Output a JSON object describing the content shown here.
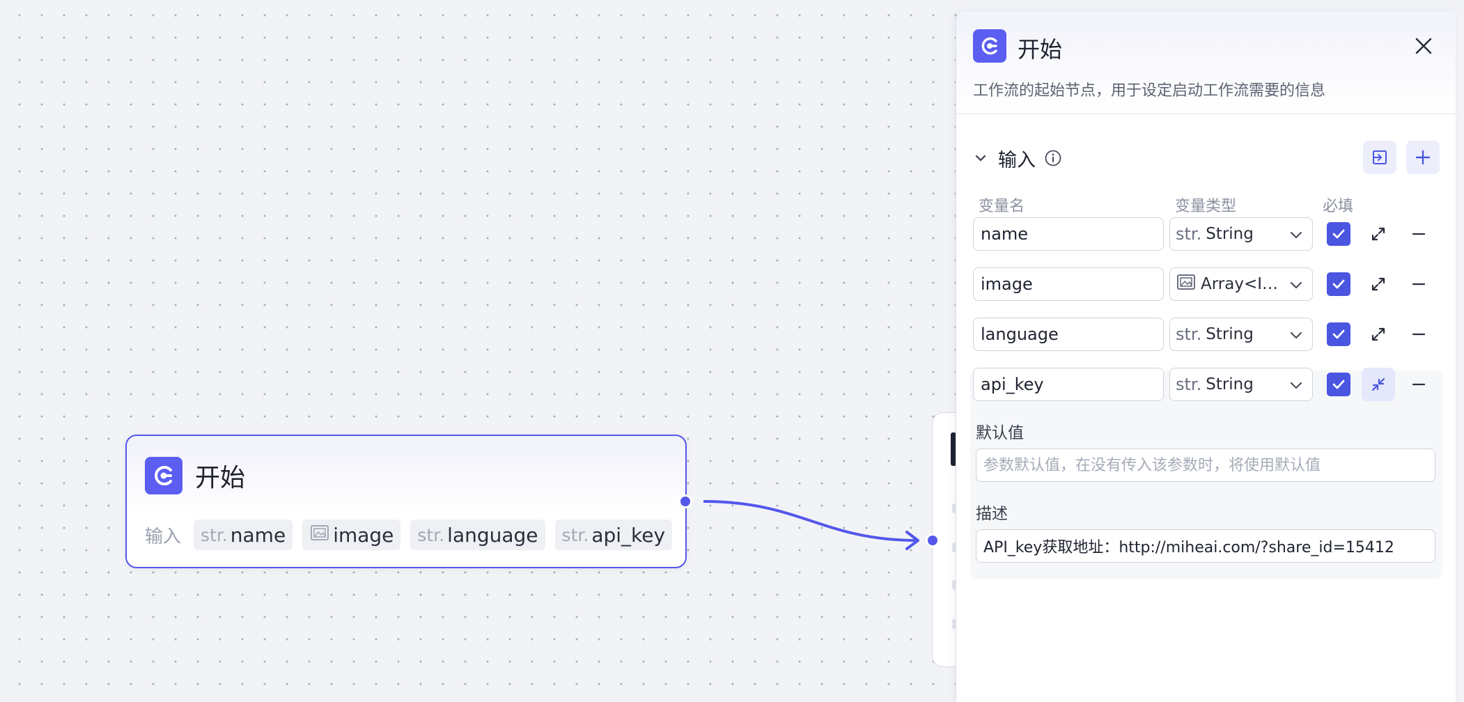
{
  "canvas": {
    "start_node": {
      "title": "开始",
      "inputs_label": "输入",
      "variables": [
        {
          "type_tag": "str.",
          "name": "name",
          "icon": "string-type-icon"
        },
        {
          "type_tag": "",
          "name": "image",
          "icon": "image-array-icon"
        },
        {
          "type_tag": "str.",
          "name": "language",
          "icon": "string-type-icon"
        },
        {
          "type_tag": "str.",
          "name": "api_key",
          "icon": "string-type-icon"
        }
      ]
    }
  },
  "panel": {
    "title": "开始",
    "description": "工作流的起始节点，用于设定启动工作流需要的信息",
    "section_title": "输入",
    "columns": {
      "name": "变量名",
      "type": "变量类型",
      "required": "必填"
    },
    "variables": [
      {
        "name": "name",
        "type_tag": "str.",
        "type": "String",
        "required": true,
        "expanded": false
      },
      {
        "name": "image",
        "type_tag": "",
        "type": "Array<I…",
        "required": true,
        "expanded": false
      },
      {
        "name": "language",
        "type_tag": "str.",
        "type": "String",
        "required": true,
        "expanded": false
      },
      {
        "name": "api_key",
        "type_tag": "str.",
        "type": "String",
        "required": true,
        "expanded": true
      }
    ],
    "default_value": {
      "label": "默认值",
      "placeholder": "参数默认值，在没有传入该参数时，将使用默认值",
      "value": ""
    },
    "description_field": {
      "label": "描述",
      "value": "API_key获取地址：http://miheai.com/?share_id=15412"
    }
  },
  "colors": {
    "accent": "#5457ea",
    "logo_bg": "#5b5ef0",
    "checkbox": "#4a55e0"
  }
}
